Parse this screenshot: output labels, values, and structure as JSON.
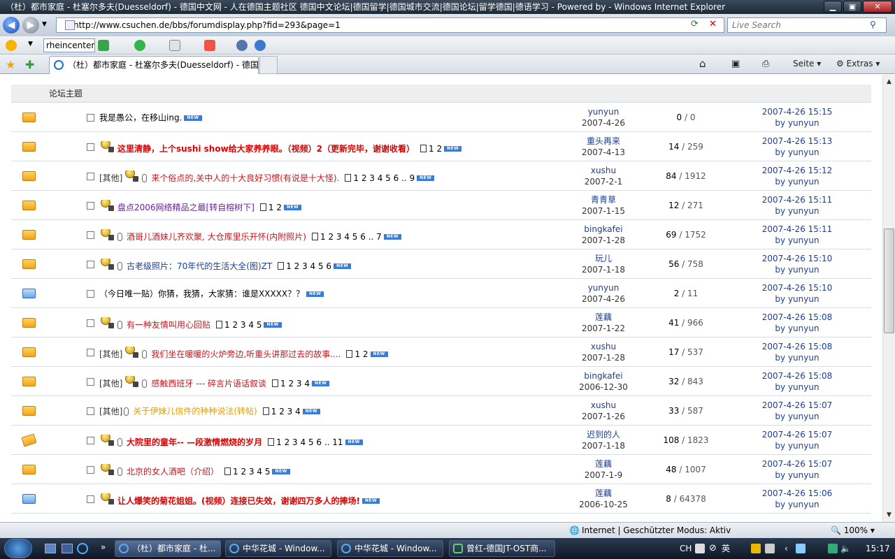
{
  "window": {
    "title": "（杜）都市家庭 - 杜塞尔多夫(Duesseldorf) - 德国中文网 - 人在德国主题社区 德国中文论坛|德国留学|德国城市交流|德国论坛|留学德国|德语学习 - Powered by  - Windows Internet Explorer",
    "minimize": "▁",
    "maximize": "▣",
    "close": "✕"
  },
  "browser": {
    "url": "http://www.csuchen.de/bbs/forumdisplay.php?fid=293&page=1",
    "search_placeholder": "Live Search",
    "toolbar_input": "rheincenter k",
    "tab_title": "（杜）都市家庭 - 杜塞尔多夫(Duesseldorf) - 德国...",
    "tools": {
      "page": "Seite",
      "extras": "Extras"
    }
  },
  "forum": {
    "header_label": "论坛主题",
    "threads": [
      {
        "icon": "folder",
        "medal": false,
        "category": "",
        "clip": false,
        "title": "我是愚公，在移山ing.",
        "style": "plain",
        "pages": "",
        "author": "yunyun",
        "date": "2007-4-26",
        "replies": "0",
        "views": "0",
        "last_time": "2007-4-26 15:15",
        "last_by": "by yunyun"
      },
      {
        "icon": "folder",
        "medal": true,
        "category": "",
        "clip": false,
        "title": "这里清静，上个sushi show给大家养养眼。（视频）2（更新完毕，谢谢收看）",
        "style": "red",
        "pages": "1 2",
        "author": "重头再来",
        "date": "2007-4-13",
        "replies": "14",
        "views": "259",
        "last_time": "2007-4-26 15:13",
        "last_by": "by yunyun"
      },
      {
        "icon": "folder",
        "medal": true,
        "category": "[其他]",
        "clip": true,
        "title": "来个俗点的,关中人的十大良好习惯(有说是十大怪).",
        "style": "redn",
        "pages": "1 2 3 4 5 6 .. 9",
        "author": "xushu",
        "date": "2007-2-1",
        "replies": "84",
        "views": "1912",
        "last_time": "2007-4-26 15:12",
        "last_by": "by yunyun"
      },
      {
        "icon": "folder",
        "medal": true,
        "category": "",
        "clip": false,
        "title": "盘点2006网络精品之最[转自榕树下]",
        "style": "purple",
        "pages": "1 2",
        "author": "青青草",
        "date": "2007-1-15",
        "replies": "12",
        "views": "271",
        "last_time": "2007-4-26 15:11",
        "last_by": "by yunyun"
      },
      {
        "icon": "folder",
        "medal": true,
        "category": "",
        "clip": true,
        "title": "酒哥儿酒妹儿齐欢聚, 大仓库里乐开怀(内附照片)",
        "style": "redn",
        "pages": "1 2 3 4 5 6 .. 7",
        "author": "bingkafei",
        "date": "2007-1-28",
        "replies": "69",
        "views": "1752",
        "last_time": "2007-4-26 15:11",
        "last_by": "by yunyun"
      },
      {
        "icon": "folder",
        "medal": true,
        "category": "",
        "clip": true,
        "title": "古老级照片：70年代的生活大全(图)ZT",
        "style": "blue",
        "pages": "1 2 3 4 5 6",
        "author": "玩儿",
        "date": "2007-1-18",
        "replies": "56",
        "views": "758",
        "last_time": "2007-4-26 15:10",
        "last_by": "by yunyun"
      },
      {
        "icon": "blue",
        "medal": false,
        "category": "",
        "clip": false,
        "title": "（今日唯一贴）你猜，我猜，大家猜：谁是XXXXX？？",
        "style": "plain",
        "pages": "",
        "author": "yunyun",
        "date": "2007-4-26",
        "replies": "2",
        "views": "11",
        "last_time": "2007-4-26 15:10",
        "last_by": "by yunyun"
      },
      {
        "icon": "folder",
        "medal": true,
        "category": "",
        "clip": true,
        "title": "有一种友情叫用心回贴",
        "style": "redn",
        "pages": "1 2 3 4 5",
        "author": "莲藕",
        "date": "2007-1-22",
        "replies": "41",
        "views": "966",
        "last_time": "2007-4-26 15:08",
        "last_by": "by yunyun"
      },
      {
        "icon": "folder",
        "medal": true,
        "category": "[其他]",
        "clip": true,
        "title": "我们坐在暖暖的火炉旁边,听重头讲那过去的故事....",
        "style": "redn",
        "pages": "1 2",
        "author": "xushu",
        "date": "2007-1-28",
        "replies": "17",
        "views": "537",
        "last_time": "2007-4-26 15:08",
        "last_by": "by yunyun"
      },
      {
        "icon": "folder",
        "medal": true,
        "category": "[其他]",
        "clip": true,
        "title": "感触西班牙 --- 碎言片语话叙谈",
        "style": "redn",
        "pages": "1 2 3 4",
        "author": "bingkafei",
        "date": "2006-12-30",
        "replies": "32",
        "views": "843",
        "last_time": "2007-4-26 15:08",
        "last_by": "by yunyun"
      },
      {
        "icon": "folder",
        "medal": false,
        "category": "[其他]",
        "clip": true,
        "title": "关于伊妹儿信件的种种说法(转帖)",
        "style": "gold",
        "pages": "1 2 3 4",
        "author": "xushu",
        "date": "2007-1-26",
        "replies": "33",
        "views": "587",
        "last_time": "2007-4-26 15:07",
        "last_by": "by yunyun"
      },
      {
        "icon": "hot",
        "medal": true,
        "category": "",
        "clip": true,
        "title": "大院里的童年-- —段激情燃烧的岁月",
        "style": "red",
        "pages": "1 2 3 4 5 6 .. 11",
        "author": "迟到的人",
        "date": "2007-1-18",
        "replies": "108",
        "views": "1823",
        "last_time": "2007-4-26 15:07",
        "last_by": "by yunyun"
      },
      {
        "icon": "folder",
        "medal": true,
        "category": "",
        "clip": true,
        "title": "北京的女人酒吧（介绍）",
        "style": "redn",
        "pages": "1 2 3 4 5",
        "author": "莲藕",
        "date": "2007-1-9",
        "replies": "48",
        "views": "1007",
        "last_time": "2007-4-26 15:07",
        "last_by": "by yunyun"
      },
      {
        "icon": "blue",
        "medal": true,
        "category": "",
        "clip": false,
        "title": "让人爆笑的菊花姐姐。(视频）连接已失效，谢谢四万多人的捧场!",
        "style": "red",
        "pages": "",
        "author": "莲藕",
        "date": "2006-10-25",
        "replies": "8",
        "views": "64378",
        "last_time": "2007-4-26 15:06",
        "last_by": "by yunyun"
      }
    ],
    "new_badge": "NEW",
    "sep": " / "
  },
  "status": {
    "zone": "Internet | Geschützter Modus: Aktiv",
    "zoom": "100%"
  },
  "taskbar": {
    "buttons": [
      "（杜）都市家庭 - 杜...",
      "中华花城 - Window...",
      "中华花城 - Window...",
      "曾红-德国JT-OST商..."
    ],
    "lang": "CH",
    "ime": "英",
    "clock": "15:17",
    "chevron": "»"
  }
}
